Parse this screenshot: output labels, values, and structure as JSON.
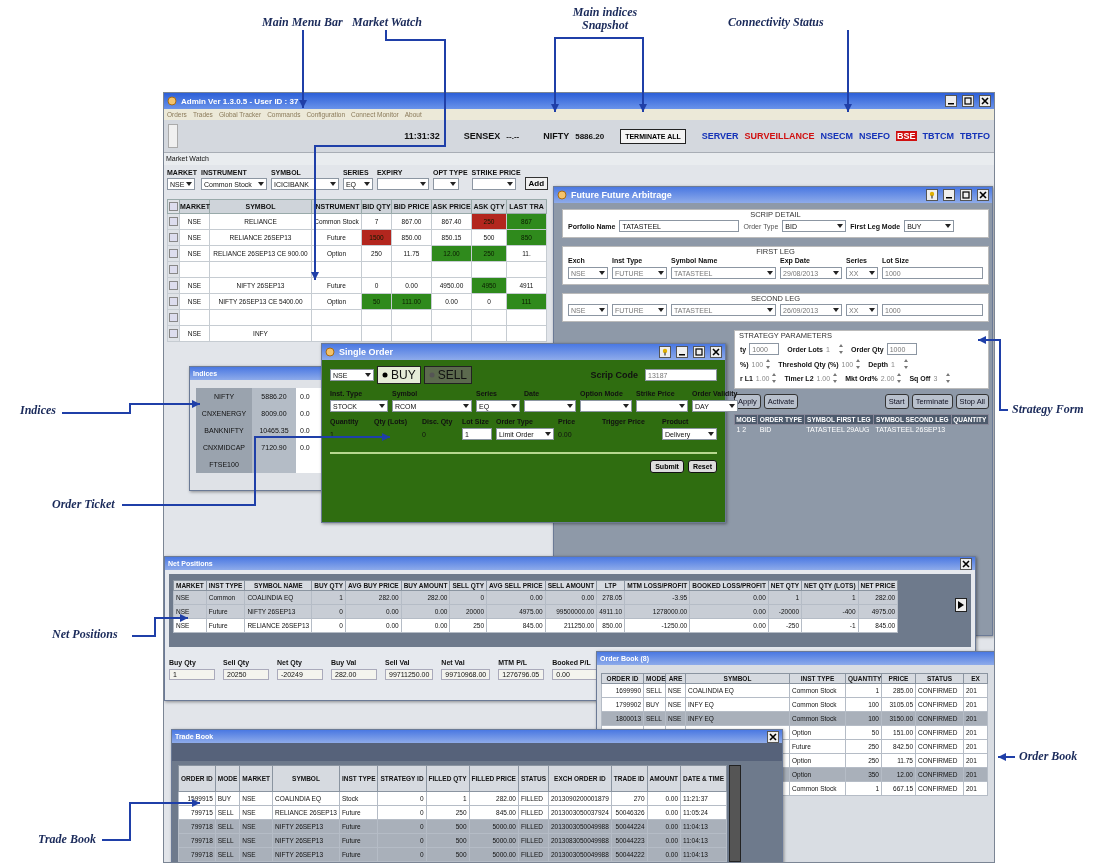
{
  "annotations": [
    "Main Menu Bar",
    "Market Watch",
    "Main indices Snapshot",
    "Connectivity Status",
    "Indices",
    "Strategy Form",
    "Order Ticket",
    "Net Positions",
    "Order Book",
    "Trade Book"
  ],
  "app": {
    "title": "Admin Ver 1.3.0.5 - User ID : 37",
    "menu": [
      "Orders",
      "Trades",
      "Global Tracker",
      "Commands",
      "Configuration",
      "Connect Monitor",
      "About"
    ],
    "clock": "11:31:32",
    "indices": [
      {
        "name": "SENSEX",
        "value": "--.--"
      },
      {
        "name": "NIFTY",
        "value": "5886.20"
      }
    ],
    "terminate_button": "TERMINATE ALL",
    "connections": [
      {
        "name": "SERVER",
        "connected": true,
        "highlighted": false
      },
      {
        "name": "SURVEILLANCE",
        "connected": false,
        "highlighted": false
      },
      {
        "name": "NSECM",
        "connected": true,
        "highlighted": false
      },
      {
        "name": "NSEFO",
        "connected": true,
        "highlighted": false
      },
      {
        "name": "BSE",
        "connected": false,
        "highlighted": true
      },
      {
        "name": "TBTCM",
        "connected": true,
        "highlighted": false
      },
      {
        "name": "TBTFO",
        "connected": true,
        "highlighted": false
      }
    ]
  },
  "market_watch": {
    "title": "Market Watch",
    "filters": [
      {
        "label": "MARKET",
        "value": "NSE"
      },
      {
        "label": "INSTRUMENT",
        "value": "Common Stock"
      },
      {
        "label": "SYMBOL",
        "value": "ICICIBANK"
      },
      {
        "label": "SERIES",
        "value": "EQ"
      },
      {
        "label": "EXPIRY"
      },
      {
        "label": "OPT TYPE"
      },
      {
        "label": "STRIKE PRICE"
      }
    ],
    "add_button": "Add",
    "select_all_checked": false,
    "columns": [
      "MARKET",
      "SYMBOL",
      "INSTRUMENT",
      "BID QTY",
      "BID PRICE",
      "ASK PRICE",
      "ASK QTY",
      "LAST TRA"
    ],
    "rows": [
      {
        "kind": "quote",
        "checked": false,
        "cells": [
          {
            "text": "NSE"
          },
          {
            "text": "RELIANCE"
          },
          {
            "text": "Common Stock"
          },
          {
            "text": "7"
          },
          {
            "text": "867.00"
          },
          {
            "text": "867.40"
          },
          {
            "text": "250",
            "color": "#b3261e"
          },
          {
            "text": "867",
            "color": "#2f8a1c"
          }
        ]
      },
      {
        "kind": "quote",
        "checked": false,
        "cells": [
          {
            "text": "NSE"
          },
          {
            "text": "RELIANCE 26SEP13"
          },
          {
            "text": "Future"
          },
          {
            "text": "1500",
            "color": "#b3261e"
          },
          {
            "text": "850.00"
          },
          {
            "text": "850.15"
          },
          {
            "text": "500"
          },
          {
            "text": "850",
            "color": "#2f8a1c"
          }
        ]
      },
      {
        "kind": "quote",
        "checked": false,
        "cells": [
          {
            "text": "NSE"
          },
          {
            "text": "RELIANCE 26SEP13 CE 900.00"
          },
          {
            "text": "Option"
          },
          {
            "text": "250"
          },
          {
            "text": "11.75"
          },
          {
            "text": "12.00",
            "color": "#2f8a1c"
          },
          {
            "text": "250",
            "color": "#2f8a1c"
          },
          {
            "text": "11."
          }
        ]
      },
      {
        "kind": "spacer",
        "checked": false
      },
      {
        "kind": "quote",
        "checked": false,
        "cells": [
          {
            "text": "NSE"
          },
          {
            "text": "NIFTY 26SEP13"
          },
          {
            "text": "Future"
          },
          {
            "text": "0"
          },
          {
            "text": "0.00"
          },
          {
            "text": "4950.00"
          },
          {
            "text": "4950",
            "color": "#2f8a1c"
          },
          {
            "text": "4911"
          }
        ]
      },
      {
        "kind": "quote",
        "checked": false,
        "cells": [
          {
            "text": "NSE"
          },
          {
            "text": "NIFTY 26SEP13 CE 5400.00"
          },
          {
            "text": "Option"
          },
          {
            "text": "50",
            "color": "#2f8a1c"
          },
          {
            "text": "111.00",
            "color": "#2f8a1c"
          },
          {
            "text": "0.00"
          },
          {
            "text": "0"
          },
          {
            "text": "111",
            "color": "#2f8a1c"
          }
        ]
      },
      {
        "kind": "spacer",
        "checked": false
      },
      {
        "kind": "quote",
        "checked": false,
        "cells": [
          {
            "text": "NSE"
          },
          {
            "text": "INFY"
          }
        ]
      }
    ]
  },
  "arbitrage": {
    "title": "Future Future Arbitrage",
    "scrip_detail": {
      "legend": "SCRIP DETAIL",
      "fields": [
        {
          "label": "Porfolio Name",
          "value": "TATASTEEL",
          "kind": "text"
        },
        {
          "label": "Order Type",
          "value": "BID",
          "kind": "select"
        },
        {
          "label": "First Leg Mode",
          "value": "BUY",
          "kind": "select"
        }
      ]
    },
    "first_leg": {
      "legend": "FIRST LEG",
      "labels": [
        "Exch",
        "Inst Type",
        "Symbol Name",
        "Exp Date",
        "Series",
        "Lot Size"
      ],
      "fields": [
        {
          "value": "NSE",
          "kind": "select"
        },
        {
          "value": "FUTURE",
          "kind": "select"
        },
        {
          "value": "TATASTEEL",
          "kind": "select"
        },
        {
          "value": "29/08/2013",
          "kind": "select"
        },
        {
          "value": "XX",
          "kind": "select"
        },
        {
          "value": "1000",
          "kind": "text"
        }
      ]
    },
    "second_leg": {
      "legend": "SECOND LEG",
      "fields": [
        {
          "value": "NSE",
          "kind": "select"
        },
        {
          "value": "FUTURE",
          "kind": "select"
        },
        {
          "value": "TATASTEEL",
          "kind": "select"
        },
        {
          "value": "26/09/2013",
          "kind": "select"
        },
        {
          "value": "XX",
          "kind": "select"
        },
        {
          "value": "1000",
          "kind": "text"
        }
      ]
    },
    "strategy": {
      "legend": "STRATEGY PARAMETERS",
      "rows": [
        [
          {
            "label": "ty",
            "value": "1000",
            "kind": "text"
          },
          {
            "label": "Order Lots",
            "value": "1",
            "kind": "spin"
          },
          {
            "label": "Order Qty",
            "value": "1000",
            "kind": "text"
          }
        ],
        [
          {
            "label": "%)",
            "value": "100",
            "kind": "spin"
          },
          {
            "label": "Threshold Qty (%)",
            "value": "100",
            "kind": "spin"
          },
          {
            "label": "Depth",
            "value": "1",
            "kind": "spin"
          }
        ],
        [
          {
            "label": "r L1",
            "value": "1.00",
            "kind": "spin"
          },
          {
            "label": "Timer L2",
            "value": "1.00",
            "kind": "spin"
          },
          {
            "label": "Mkt Ord%",
            "value": "2.00",
            "kind": "spin"
          },
          {
            "label": "Sq Off",
            "value": "3",
            "kind": "spin"
          }
        ]
      ]
    },
    "buttons": [
      "Apply",
      "Activate",
      "Start",
      "Terminate",
      "Stop All"
    ],
    "grid": {
      "columns": [
        "MODE",
        "ORDER TYPE",
        "SYMBOL FIRST LEG",
        "SYMBOL SECOND LEG",
        "QUANTITY"
      ],
      "rows": [
        [
          "1 2",
          "BID",
          "TATASTEEL 29AUG",
          "TATASTEEL 26SEP13"
        ]
      ]
    }
  },
  "single_order": {
    "title": "Single Order",
    "market": "NSE",
    "sides": [
      {
        "label": "BUY",
        "selected": true
      },
      {
        "label": "SELL",
        "selected": false
      }
    ],
    "scrip_code": {
      "label": "Scrip Code",
      "value": "13187"
    },
    "row1": [
      {
        "label": "Inst. Type",
        "value": "STOCK",
        "kind": "select"
      },
      {
        "label": "Symbol",
        "value": "RCOM",
        "kind": "select"
      },
      {
        "label": "Series",
        "value": "EQ",
        "kind": "select"
      },
      {
        "label": "Date",
        "kind": "select"
      },
      {
        "label": "Option Mode",
        "kind": "select"
      },
      {
        "label": "Strike Price",
        "kind": "select"
      },
      {
        "label": "Order Validity",
        "value": "DAY",
        "kind": "select"
      }
    ],
    "row2": [
      {
        "label": "Quantity",
        "value": "1",
        "kind": "spin"
      },
      {
        "label": "Qty (Lots)",
        "kind": "spin"
      },
      {
        "label": "Disc. Qty",
        "value": "0",
        "kind": "spin"
      },
      {
        "label": "Lot Size",
        "value": "1",
        "kind": "text"
      },
      {
        "label": "Order Type",
        "value": "Limit Order",
        "kind": "select"
      },
      {
        "label": "Price",
        "value": "0.00",
        "kind": "spin"
      },
      {
        "label": "Trigger Price",
        "kind": "spin"
      },
      {
        "label": "Product",
        "value": "Delivery",
        "kind": "select"
      }
    ],
    "buttons": [
      "Submit",
      "Reset"
    ]
  },
  "indices_window": {
    "title": "Indices",
    "rows": [
      {
        "name": "NIFTY",
        "value": "5886.20",
        "change": "0.0"
      },
      {
        "name": "CNXENERGY",
        "value": "8009.00",
        "change": "0.0"
      },
      {
        "name": "BANKNIFTY",
        "value": "10465.35",
        "change": "0.0"
      },
      {
        "name": "CNXMIDCAP",
        "value": "7120.90",
        "change": "0.0"
      },
      {
        "name": "FTSE100"
      }
    ]
  },
  "net_positions": {
    "title": "Net Positions",
    "columns": [
      "MARKET",
      "INST TYPE",
      "SYMBOL NAME",
      "BUY QTY",
      "AVG BUY PRICE",
      "BUY AMOUNT",
      "SELL QTY",
      "AVG SELL PRICE",
      "SELL AMOUNT",
      "LTP",
      "MTM LOSS/PROFIT",
      "BOOKED LOSS/PROFIT",
      "NET QTY",
      "NET QTY (LOTS)",
      "NET PRICE"
    ],
    "rows": [
      [
        "NSE",
        "Common",
        "COALINDIA EQ",
        "1",
        "282.00",
        "282.00",
        "0",
        "0.00",
        "0.00",
        "278.05",
        "-3.95",
        "0.00",
        "1",
        "1",
        "282.00"
      ],
      [
        "NSE",
        "Future",
        "NIFTY 26SEP13",
        "0",
        "0.00",
        "0.00",
        "20000",
        "4975.00",
        "99500000.00",
        "4911.10",
        "1278000.00",
        "0.00",
        "-20000",
        "-400",
        "4975.00"
      ],
      [
        "NSE",
        "Future",
        "RELIANCE 26SEP13",
        "0",
        "0.00",
        "0.00",
        "250",
        "845.00",
        "211250.00",
        "850.00",
        "-1250.00",
        "0.00",
        "-250",
        "-1",
        "845.00"
      ]
    ],
    "summary": [
      {
        "label": "Buy Qty",
        "value": "1"
      },
      {
        "label": "Sell Qty",
        "value": "20250"
      },
      {
        "label": "Net Qty",
        "value": "-20249"
      },
      {
        "label": "Buy Val",
        "value": "282.00"
      },
      {
        "label": "Sell Val",
        "value": "99711250.00"
      },
      {
        "label": "Net Val",
        "value": "99710968.00"
      },
      {
        "label": "MTM P/L",
        "value": "1276796.05"
      },
      {
        "label": "Booked P/L",
        "value": "0.00"
      }
    ]
  },
  "order_book": {
    "title": "Order Book (8)",
    "columns": [
      "ORDER ID",
      "MODE",
      "ARE",
      "SYMBOL",
      "INST TYPE",
      "QUANTITY",
      "PRICE",
      "STATUS",
      "EX"
    ],
    "rows": [
      {
        "selected": false,
        "cells": [
          "1699990",
          "SELL",
          "NSE",
          "COALINDIA EQ",
          "Common Stock",
          "1",
          "285.00",
          "CONFIRMED",
          "201"
        ]
      },
      {
        "selected": false,
        "cells": [
          "1799902",
          "BUY",
          "NSE",
          "INFY EQ",
          "Common Stock",
          "100",
          "3105.05",
          "CONFIRMED",
          "201"
        ]
      },
      {
        "selected": true,
        "cells": [
          "1800013",
          "SELL",
          "NSE",
          "INFY EQ",
          "Common Stock",
          "100",
          "3150.00",
          "CONFIRMED",
          "201"
        ]
      },
      {
        "selected": false,
        "cells": [
          "Option",
          "50",
          "151.00",
          "CONFIRMED",
          "201"
        ]
      },
      {
        "selected": false,
        "cells": [
          "Future",
          "250",
          "842.50",
          "CONFIRMED",
          "201"
        ]
      },
      {
        "selected": false,
        "cells": [
          "Option",
          "250",
          "11.75",
          "CONFIRMED",
          "201"
        ]
      },
      {
        "selected": true,
        "cells": [
          "Option",
          "350",
          "12.00",
          "CONFIRMED",
          "201"
        ]
      },
      {
        "selected": false,
        "cells": [
          "Common Stock",
          "1",
          "667.15",
          "CONFIRMED",
          "201"
        ]
      }
    ]
  },
  "trade_book": {
    "title": "Trade Book",
    "columns": [
      "ORDER ID",
      "MODE",
      "MARKET",
      "SYMBOL",
      "INST TYPE",
      "STRATEGY ID",
      "FILLED QTY",
      "FILLED PRICE",
      "STATUS",
      "EXCH ORDER ID",
      "TRADE ID",
      "AMOUNT",
      "DATE & TIME"
    ],
    "rows": [
      {
        "selected": false,
        "cells": [
          "1599915",
          "BUY",
          "NSE",
          "COALINDIA EQ",
          "Stock",
          "0",
          "1",
          "282.00",
          "FILLED",
          "2013090200001879",
          "270",
          "0.00",
          "11:21:37"
        ]
      },
      {
        "selected": false,
        "cells": [
          "799715",
          "SELL",
          "NSE",
          "RELIANCE 26SEP13",
          "Future",
          "0",
          "250",
          "845.00",
          "FILLED",
          "2013003050037924",
          "50046326",
          "0.00",
          "11:05:24"
        ]
      },
      {
        "selected": true,
        "cells": [
          "799718",
          "SELL",
          "NSE",
          "NIFTY 26SEP13",
          "Future",
          "0",
          "500",
          "5000.00",
          "FILLED",
          "2013003050049988",
          "50044224",
          "0.00",
          "11:04:13"
        ]
      },
      {
        "selected": true,
        "cells": [
          "799718",
          "SELL",
          "NSE",
          "NIFTY 26SEP13",
          "Future",
          "0",
          "500",
          "5000.00",
          "FILLED",
          "2013083050049988",
          "50044223",
          "0.00",
          "11:04:13"
        ]
      },
      {
        "selected": true,
        "cells": [
          "799718",
          "SELL",
          "NSE",
          "NIFTY 26SEP13",
          "Future",
          "0",
          "500",
          "5000.00",
          "FILLED",
          "2013003050049988",
          "50044222",
          "0.00",
          "11:04:13"
        ]
      }
    ]
  }
}
